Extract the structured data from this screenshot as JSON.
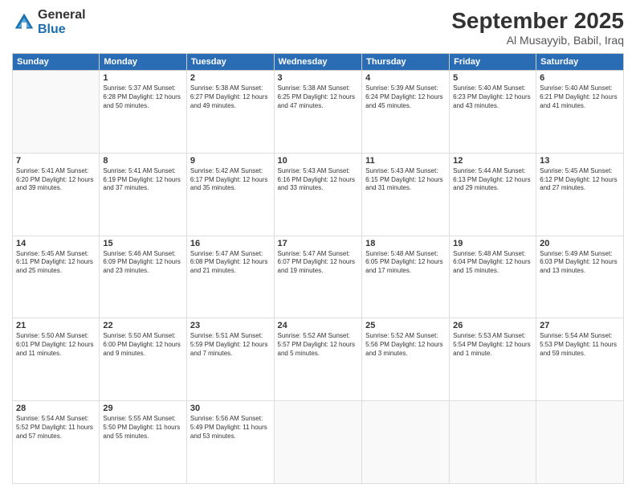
{
  "logo": {
    "general": "General",
    "blue": "Blue"
  },
  "header": {
    "month": "September 2025",
    "location": "Al Musayyib, Babil, Iraq"
  },
  "weekdays": [
    "Sunday",
    "Monday",
    "Tuesday",
    "Wednesday",
    "Thursday",
    "Friday",
    "Saturday"
  ],
  "weeks": [
    [
      {
        "day": "",
        "info": ""
      },
      {
        "day": "1",
        "info": "Sunrise: 5:37 AM\nSunset: 6:28 PM\nDaylight: 12 hours\nand 50 minutes."
      },
      {
        "day": "2",
        "info": "Sunrise: 5:38 AM\nSunset: 6:27 PM\nDaylight: 12 hours\nand 49 minutes."
      },
      {
        "day": "3",
        "info": "Sunrise: 5:38 AM\nSunset: 6:25 PM\nDaylight: 12 hours\nand 47 minutes."
      },
      {
        "day": "4",
        "info": "Sunrise: 5:39 AM\nSunset: 6:24 PM\nDaylight: 12 hours\nand 45 minutes."
      },
      {
        "day": "5",
        "info": "Sunrise: 5:40 AM\nSunset: 6:23 PM\nDaylight: 12 hours\nand 43 minutes."
      },
      {
        "day": "6",
        "info": "Sunrise: 5:40 AM\nSunset: 6:21 PM\nDaylight: 12 hours\nand 41 minutes."
      }
    ],
    [
      {
        "day": "7",
        "info": "Sunrise: 5:41 AM\nSunset: 6:20 PM\nDaylight: 12 hours\nand 39 minutes."
      },
      {
        "day": "8",
        "info": "Sunrise: 5:41 AM\nSunset: 6:19 PM\nDaylight: 12 hours\nand 37 minutes."
      },
      {
        "day": "9",
        "info": "Sunrise: 5:42 AM\nSunset: 6:17 PM\nDaylight: 12 hours\nand 35 minutes."
      },
      {
        "day": "10",
        "info": "Sunrise: 5:43 AM\nSunset: 6:16 PM\nDaylight: 12 hours\nand 33 minutes."
      },
      {
        "day": "11",
        "info": "Sunrise: 5:43 AM\nSunset: 6:15 PM\nDaylight: 12 hours\nand 31 minutes."
      },
      {
        "day": "12",
        "info": "Sunrise: 5:44 AM\nSunset: 6:13 PM\nDaylight: 12 hours\nand 29 minutes."
      },
      {
        "day": "13",
        "info": "Sunrise: 5:45 AM\nSunset: 6:12 PM\nDaylight: 12 hours\nand 27 minutes."
      }
    ],
    [
      {
        "day": "14",
        "info": "Sunrise: 5:45 AM\nSunset: 6:11 PM\nDaylight: 12 hours\nand 25 minutes."
      },
      {
        "day": "15",
        "info": "Sunrise: 5:46 AM\nSunset: 6:09 PM\nDaylight: 12 hours\nand 23 minutes."
      },
      {
        "day": "16",
        "info": "Sunrise: 5:47 AM\nSunset: 6:08 PM\nDaylight: 12 hours\nand 21 minutes."
      },
      {
        "day": "17",
        "info": "Sunrise: 5:47 AM\nSunset: 6:07 PM\nDaylight: 12 hours\nand 19 minutes."
      },
      {
        "day": "18",
        "info": "Sunrise: 5:48 AM\nSunset: 6:05 PM\nDaylight: 12 hours\nand 17 minutes."
      },
      {
        "day": "19",
        "info": "Sunrise: 5:48 AM\nSunset: 6:04 PM\nDaylight: 12 hours\nand 15 minutes."
      },
      {
        "day": "20",
        "info": "Sunrise: 5:49 AM\nSunset: 6:03 PM\nDaylight: 12 hours\nand 13 minutes."
      }
    ],
    [
      {
        "day": "21",
        "info": "Sunrise: 5:50 AM\nSunset: 6:01 PM\nDaylight: 12 hours\nand 11 minutes."
      },
      {
        "day": "22",
        "info": "Sunrise: 5:50 AM\nSunset: 6:00 PM\nDaylight: 12 hours\nand 9 minutes."
      },
      {
        "day": "23",
        "info": "Sunrise: 5:51 AM\nSunset: 5:59 PM\nDaylight: 12 hours\nand 7 minutes."
      },
      {
        "day": "24",
        "info": "Sunrise: 5:52 AM\nSunset: 5:57 PM\nDaylight: 12 hours\nand 5 minutes."
      },
      {
        "day": "25",
        "info": "Sunrise: 5:52 AM\nSunset: 5:56 PM\nDaylight: 12 hours\nand 3 minutes."
      },
      {
        "day": "26",
        "info": "Sunrise: 5:53 AM\nSunset: 5:54 PM\nDaylight: 12 hours\nand 1 minute."
      },
      {
        "day": "27",
        "info": "Sunrise: 5:54 AM\nSunset: 5:53 PM\nDaylight: 11 hours\nand 59 minutes."
      }
    ],
    [
      {
        "day": "28",
        "info": "Sunrise: 5:54 AM\nSunset: 5:52 PM\nDaylight: 11 hours\nand 57 minutes."
      },
      {
        "day": "29",
        "info": "Sunrise: 5:55 AM\nSunset: 5:50 PM\nDaylight: 11 hours\nand 55 minutes."
      },
      {
        "day": "30",
        "info": "Sunrise: 5:56 AM\nSunset: 5:49 PM\nDaylight: 11 hours\nand 53 minutes."
      },
      {
        "day": "",
        "info": ""
      },
      {
        "day": "",
        "info": ""
      },
      {
        "day": "",
        "info": ""
      },
      {
        "day": "",
        "info": ""
      }
    ]
  ]
}
